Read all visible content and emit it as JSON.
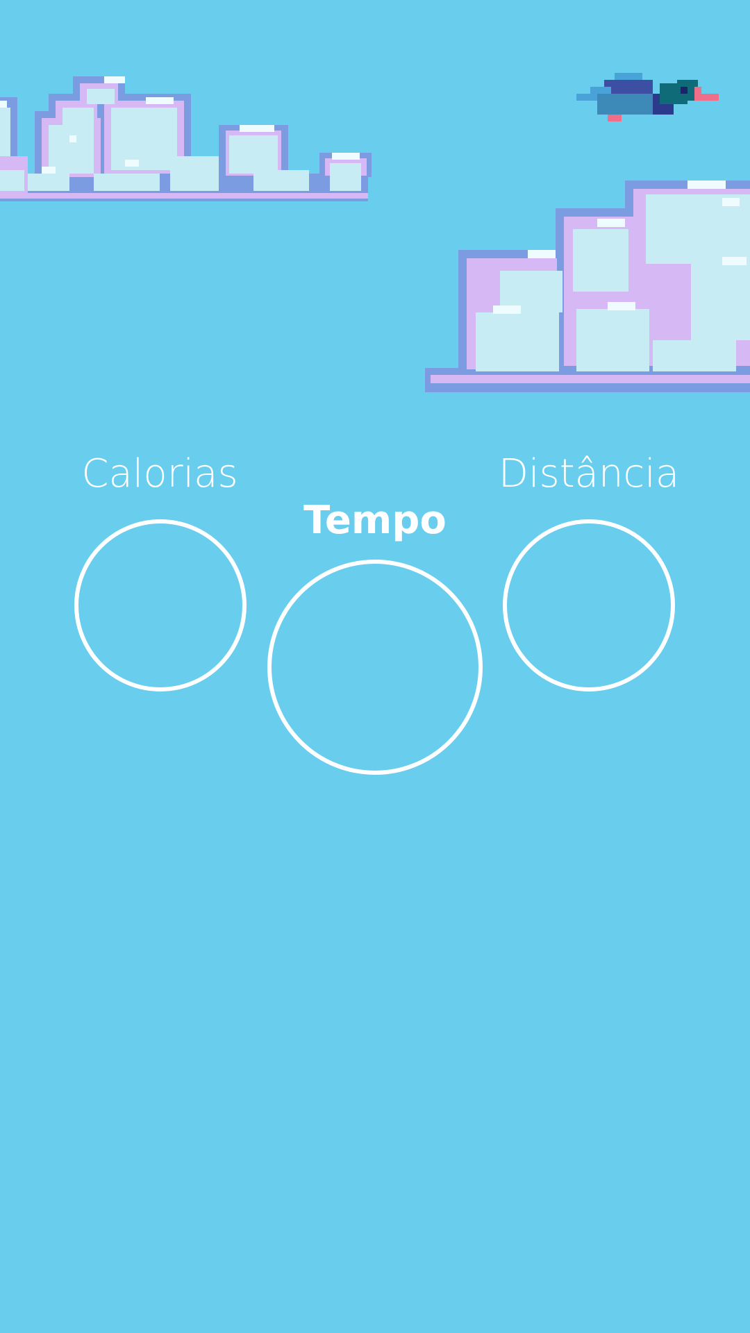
{
  "screen": {
    "background_color": "#69cded",
    "accent_color": "#ffffff"
  },
  "decorations": {
    "clouds": [
      "pixel-cloud",
      "pixel-cloud"
    ],
    "bird": "pixel-duck"
  },
  "stats": {
    "calories": {
      "label": "Calorias",
      "value": ""
    },
    "time": {
      "label": "Tempo",
      "value": ""
    },
    "distance": {
      "label": "Distância",
      "value": ""
    }
  }
}
